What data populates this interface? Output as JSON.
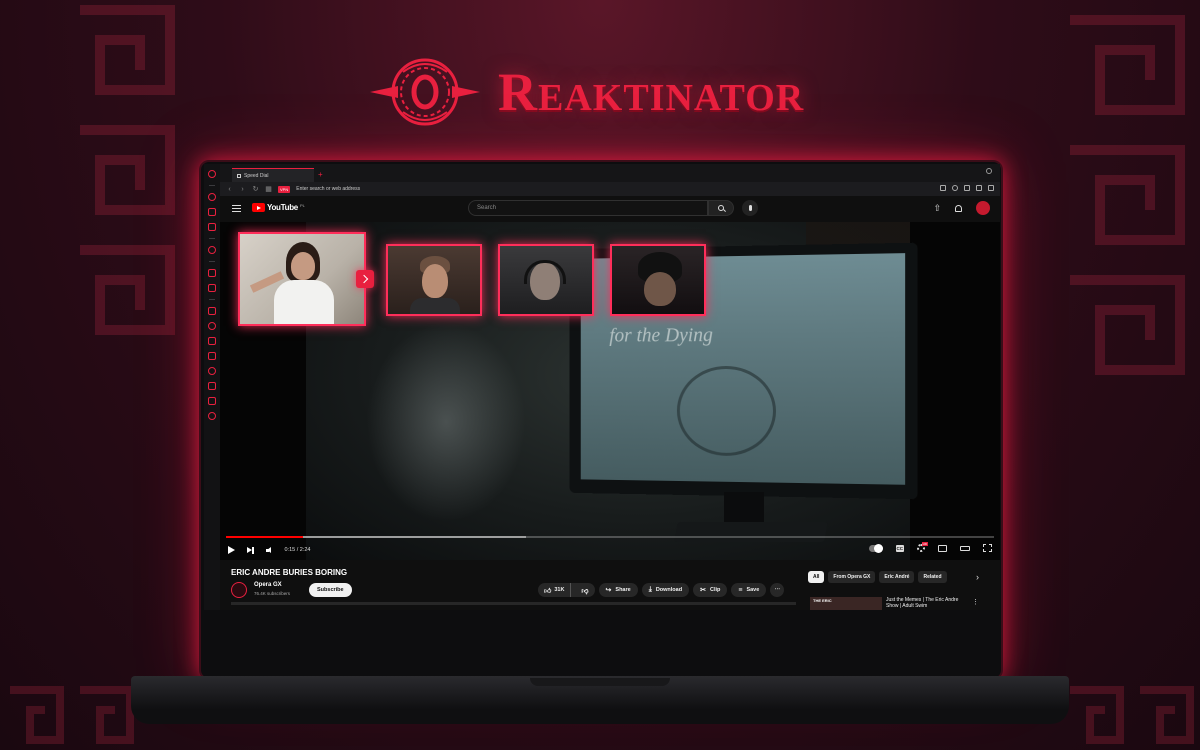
{
  "brand": {
    "name": "Reaktinator",
    "accent_color": "#e8203f"
  },
  "browser": {
    "tab_title": "Speed Dial",
    "address_placeholder": "Enter search or web address",
    "vpn_label": "VPN",
    "sidebar_icons": [
      "gx-control-icon",
      "gx-corner-icon",
      "twitch-icon",
      "tiktok-icon",
      "telegram-icon",
      "instagram-icon",
      "apps-icon",
      "heart-icon",
      "player-icon",
      "pin-icon",
      "history-icon",
      "download-icon",
      "cube-icon",
      "settings-icon"
    ]
  },
  "youtube": {
    "logo_text": "YouTube",
    "region": "PL",
    "search_placeholder": "Search",
    "video": {
      "time": "0:15 / 2:24",
      "progress": 0.1,
      "buffered": 0.39,
      "title": "ERIC ANDRE BURIES BORING",
      "scene_text": "for the Dying"
    },
    "channel": {
      "name": "Opera GX",
      "subscribers": "76.4K subscribers",
      "subscribe_label": "Subscribe"
    },
    "actions": {
      "likes": "31K",
      "share": "Share",
      "download": "Download",
      "clip": "Clip",
      "save": "Save",
      "more": "⋯"
    },
    "chips": [
      "All",
      "From Opera GX",
      "Eric André",
      "Related"
    ],
    "recommendation": {
      "thumb_label": "THE ERIC",
      "title": "Just the Memes | The Eric Andre Show | Adult Swim"
    }
  }
}
